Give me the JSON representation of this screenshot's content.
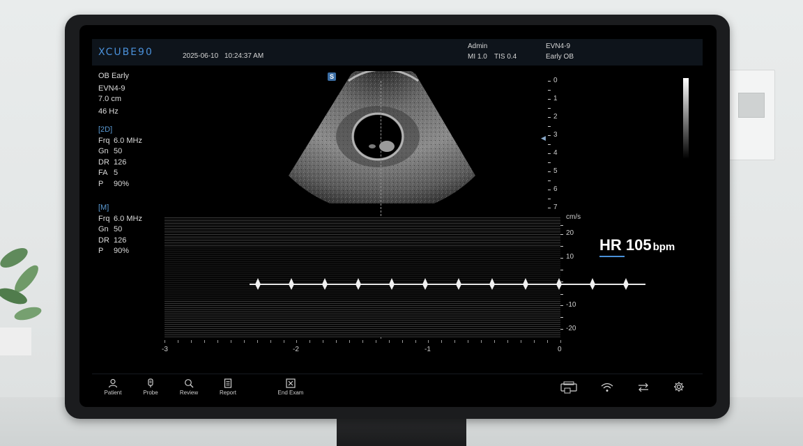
{
  "brand": "XCUBE90",
  "topbar": {
    "date": "2025-06-10",
    "time": "10:24:37 AM",
    "user": "Admin",
    "mi": "MI 1.0",
    "tis": "TIS 0.4",
    "probe": "EVN4-9",
    "preset": "Early OB"
  },
  "general": {
    "exam": "OB Early",
    "probe": "EVN4-9",
    "depth": "7.0 cm",
    "rate": "46 Hz"
  },
  "mode_2d": {
    "header": "[2D]",
    "frq_k": "Frq",
    "frq_v": "6.0 MHz",
    "gn_k": "Gn",
    "gn_v": "50",
    "dr_k": "DR",
    "dr_v": "126",
    "fa_k": "FA",
    "fa_v": "5",
    "p_k": "P",
    "p_v": "90%"
  },
  "mode_m": {
    "header": "[M]",
    "frq_k": "Frq",
    "frq_v": "6.0 MHz",
    "gn_k": "Gn",
    "gn_v": "50",
    "dr_k": "DR",
    "dr_v": "126",
    "p_k": "P",
    "p_v": "90%"
  },
  "s_badge": "S",
  "depth_scale": [
    "0",
    "1",
    "2",
    "3",
    "4",
    "5",
    "6",
    "7"
  ],
  "velocity_scale": {
    "unit": "cm/s",
    "labels": [
      "20",
      "10",
      "-10",
      "-20"
    ]
  },
  "time_axis": [
    "-3",
    "-2",
    "-1",
    "0"
  ],
  "heart_rate": {
    "label": "HR 105",
    "unit": "bpm"
  },
  "nav": {
    "patient": "Patient",
    "probe": "Probe",
    "review": "Review",
    "report": "Report",
    "end_exam": "End Exam"
  }
}
